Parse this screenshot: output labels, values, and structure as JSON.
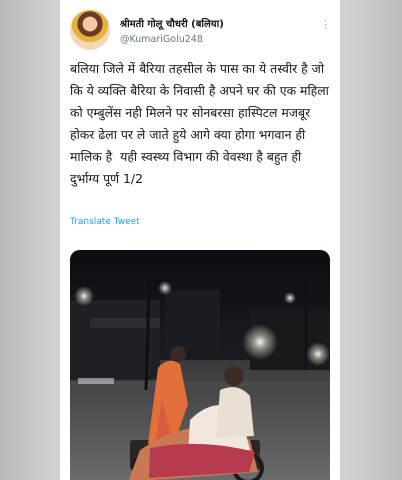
{
  "tweet": {
    "display_name": "श्रीमती गोलू चौधरी (बलिया)",
    "handle": "@KumariGolu248",
    "text": "बलिया जिले में बैरिया तहसील के पास का ये तस्वीर है जो कि ये व्यक्ति बैरिया के निवासी है अपने घर की एक महिला को एम्बुलेंस नही मिलने पर सोनबरसा हास्पिटल मजबूर होकर ढेला पर ले जाते हुये आगे क्या होगा भगवान ही मालिक है  यही स्वस्थ्य विभाग की वेवस्था है बहुत ही दुर्भाग्य पूर्ण 1/2",
    "translate_label": "Translate Tweet"
  },
  "icons": {
    "more": "more-icon",
    "avatar": "avatar"
  },
  "colors": {
    "link": "#1da1f2",
    "secondary_text": "#657786",
    "primary_text": "#14171a",
    "card_bg": "#ffffff"
  }
}
